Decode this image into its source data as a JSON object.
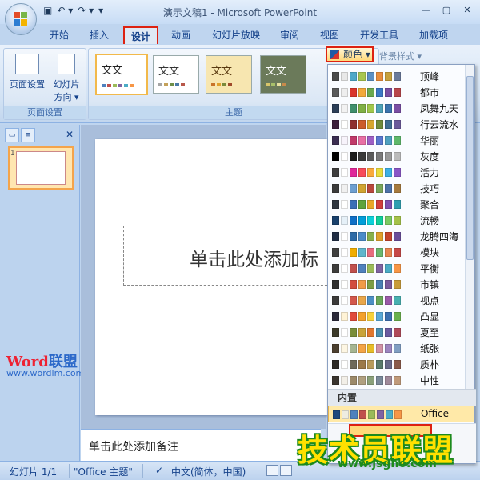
{
  "window": {
    "title": "演示文稿1 - Microsoft PowerPoint"
  },
  "tabs": [
    "开始",
    "插入",
    "设计",
    "动画",
    "幻灯片放映",
    "审阅",
    "视图",
    "开发工具",
    "加载项"
  ],
  "active_tab": "设计",
  "ribbon": {
    "page_setup_label": "页面设置",
    "orientation_label_1": "幻灯片",
    "orientation_label_2": "方向 ▾",
    "page_setup_group": "页面设置",
    "themes_group": "主题",
    "theme_text": "文文",
    "colors_button": "颜色",
    "background_styles": "背景样式 ▾"
  },
  "slide": {
    "placeholder_text": "单击此处添加标",
    "thumb_number": "1"
  },
  "notes_placeholder": "单击此处添加备注",
  "status": {
    "slide": "幻灯片 1/1",
    "theme": "\"Office 主题\"",
    "lang": "中文(简体，中国)"
  },
  "watermarks": {
    "word_red": "Word",
    "word_blue": "联盟",
    "word_url": "www.wordlm.com",
    "jsgho": "技术员联盟",
    "jsgho_url": "www.jsgho.com"
  },
  "color_menu": {
    "section_label": "内置",
    "builtin_name": "Office",
    "schemes": [
      {
        "name": "顶峰",
        "colors": [
          "#4a4a4a",
          "#e8e8e8",
          "#4ea8c8",
          "#a8c650",
          "#5a8fc4",
          "#e88c3c",
          "#c8a03c",
          "#6a7a9a"
        ]
      },
      {
        "name": "都市",
        "colors": [
          "#5a5a5a",
          "#eeeeee",
          "#d9342b",
          "#f2a83a",
          "#6aa84f",
          "#3b78c6",
          "#7a4ea3",
          "#b8464b"
        ]
      },
      {
        "name": "凤舞九天",
        "colors": [
          "#2c3f58",
          "#f2f2f2",
          "#3f8f6c",
          "#7fb045",
          "#a0c74b",
          "#4ea3b8",
          "#3b73ad",
          "#7a4ea3"
        ]
      },
      {
        "name": "行云流水",
        "colors": [
          "#3c1f3b",
          "#ffffff",
          "#8e2f2f",
          "#cc5c2a",
          "#d6a52e",
          "#6f8b3b",
          "#3f6e93",
          "#6b5a9a"
        ]
      },
      {
        "name": "华丽",
        "colors": [
          "#3a2d52",
          "#f7f3fb",
          "#c0396a",
          "#e86fa4",
          "#9e5fc4",
          "#5a78d0",
          "#4fa0c0",
          "#5fb86a"
        ]
      },
      {
        "name": "灰度",
        "colors": [
          "#000000",
          "#ffffff",
          "#1c1c1c",
          "#3a3a3a",
          "#5a5a5a",
          "#7a7a7a",
          "#999999",
          "#bbbbbb"
        ]
      },
      {
        "name": "活力",
        "colors": [
          "#3e3e3e",
          "#ffffff",
          "#e0279a",
          "#f84a5a",
          "#f9a93b",
          "#e9dc3b",
          "#3db0e4",
          "#8a56c6"
        ]
      },
      {
        "name": "技巧",
        "colors": [
          "#3b3b3b",
          "#f0f0f0",
          "#6e9fd0",
          "#d0a432",
          "#b8483d",
          "#7aa65a",
          "#4d72a8",
          "#a67a3e"
        ]
      },
      {
        "name": "聚合",
        "colors": [
          "#2f3640",
          "#ffffff",
          "#3b6fb6",
          "#5fa33c",
          "#e8a629",
          "#d13d3d",
          "#7f4fb0",
          "#2f9fb0"
        ]
      },
      {
        "name": "流畅",
        "colors": [
          "#17406d",
          "#e5f0f8",
          "#0f6fc6",
          "#009dd9",
          "#0bd0d9",
          "#10cf9b",
          "#7cca62",
          "#a5c249"
        ]
      },
      {
        "name": "龙腾四海",
        "colors": [
          "#1f2d45",
          "#ffffff",
          "#2d6aa6",
          "#4a8bc8",
          "#88b04b",
          "#e0a02c",
          "#c5452c",
          "#6a4e9a"
        ]
      },
      {
        "name": "模块",
        "colors": [
          "#3f3f3f",
          "#ffffff",
          "#f0ad00",
          "#60b5cc",
          "#e66c7d",
          "#6bb76d",
          "#e88651",
          "#c64847"
        ]
      },
      {
        "name": "平衡",
        "colors": [
          "#3c3c3c",
          "#ffffff",
          "#c0504d",
          "#4f81bd",
          "#9bbb59",
          "#8064a2",
          "#4bacc6",
          "#f79646"
        ]
      },
      {
        "name": "市镇",
        "colors": [
          "#2f2f2f",
          "#ffffff",
          "#d24d3e",
          "#f19b47",
          "#7c9d45",
          "#4a7fb3",
          "#7b5a9c",
          "#c89c3a"
        ]
      },
      {
        "name": "视点",
        "colors": [
          "#3a3a3a",
          "#ffffff",
          "#d2574c",
          "#e8a64a",
          "#4c8fc4",
          "#6aa85a",
          "#9a5aa8",
          "#48b0b0"
        ]
      },
      {
        "name": "凸显",
        "colors": [
          "#2a2a3a",
          "#fff3d6",
          "#e04a3b",
          "#f3a12b",
          "#f7d13b",
          "#5aa8d6",
          "#3c6fb0",
          "#6ab04c"
        ]
      },
      {
        "name": "夏至",
        "colors": [
          "#3b3a2a",
          "#ffffff",
          "#7a8e3a",
          "#c9a43b",
          "#e0772e",
          "#4a8fb0",
          "#6a5aa0",
          "#b04a5a"
        ]
      },
      {
        "name": "纸张",
        "colors": [
          "#4a3f30",
          "#fdf6e3",
          "#a5b592",
          "#f3a447",
          "#e7bc29",
          "#d092a7",
          "#9c85c0",
          "#809ec2"
        ]
      },
      {
        "name": "质朴",
        "colors": [
          "#2d2a26",
          "#ffffff",
          "#6f6a5a",
          "#9c7a4a",
          "#b89a5a",
          "#5a7a6a",
          "#6a6a8a",
          "#8a5a4a"
        ]
      },
      {
        "name": "中性",
        "colors": [
          "#3a3530",
          "#f2efe8",
          "#9c8a6a",
          "#b0a080",
          "#8aa07a",
          "#7a8a9a",
          "#a08a9a",
          "#c09a7a"
        ]
      }
    ],
    "office_colors": [
      "#1f497d",
      "#eeece1",
      "#4f81bd",
      "#c0504d",
      "#9bbb59",
      "#8064a2",
      "#4bacc6",
      "#f79646"
    ]
  }
}
